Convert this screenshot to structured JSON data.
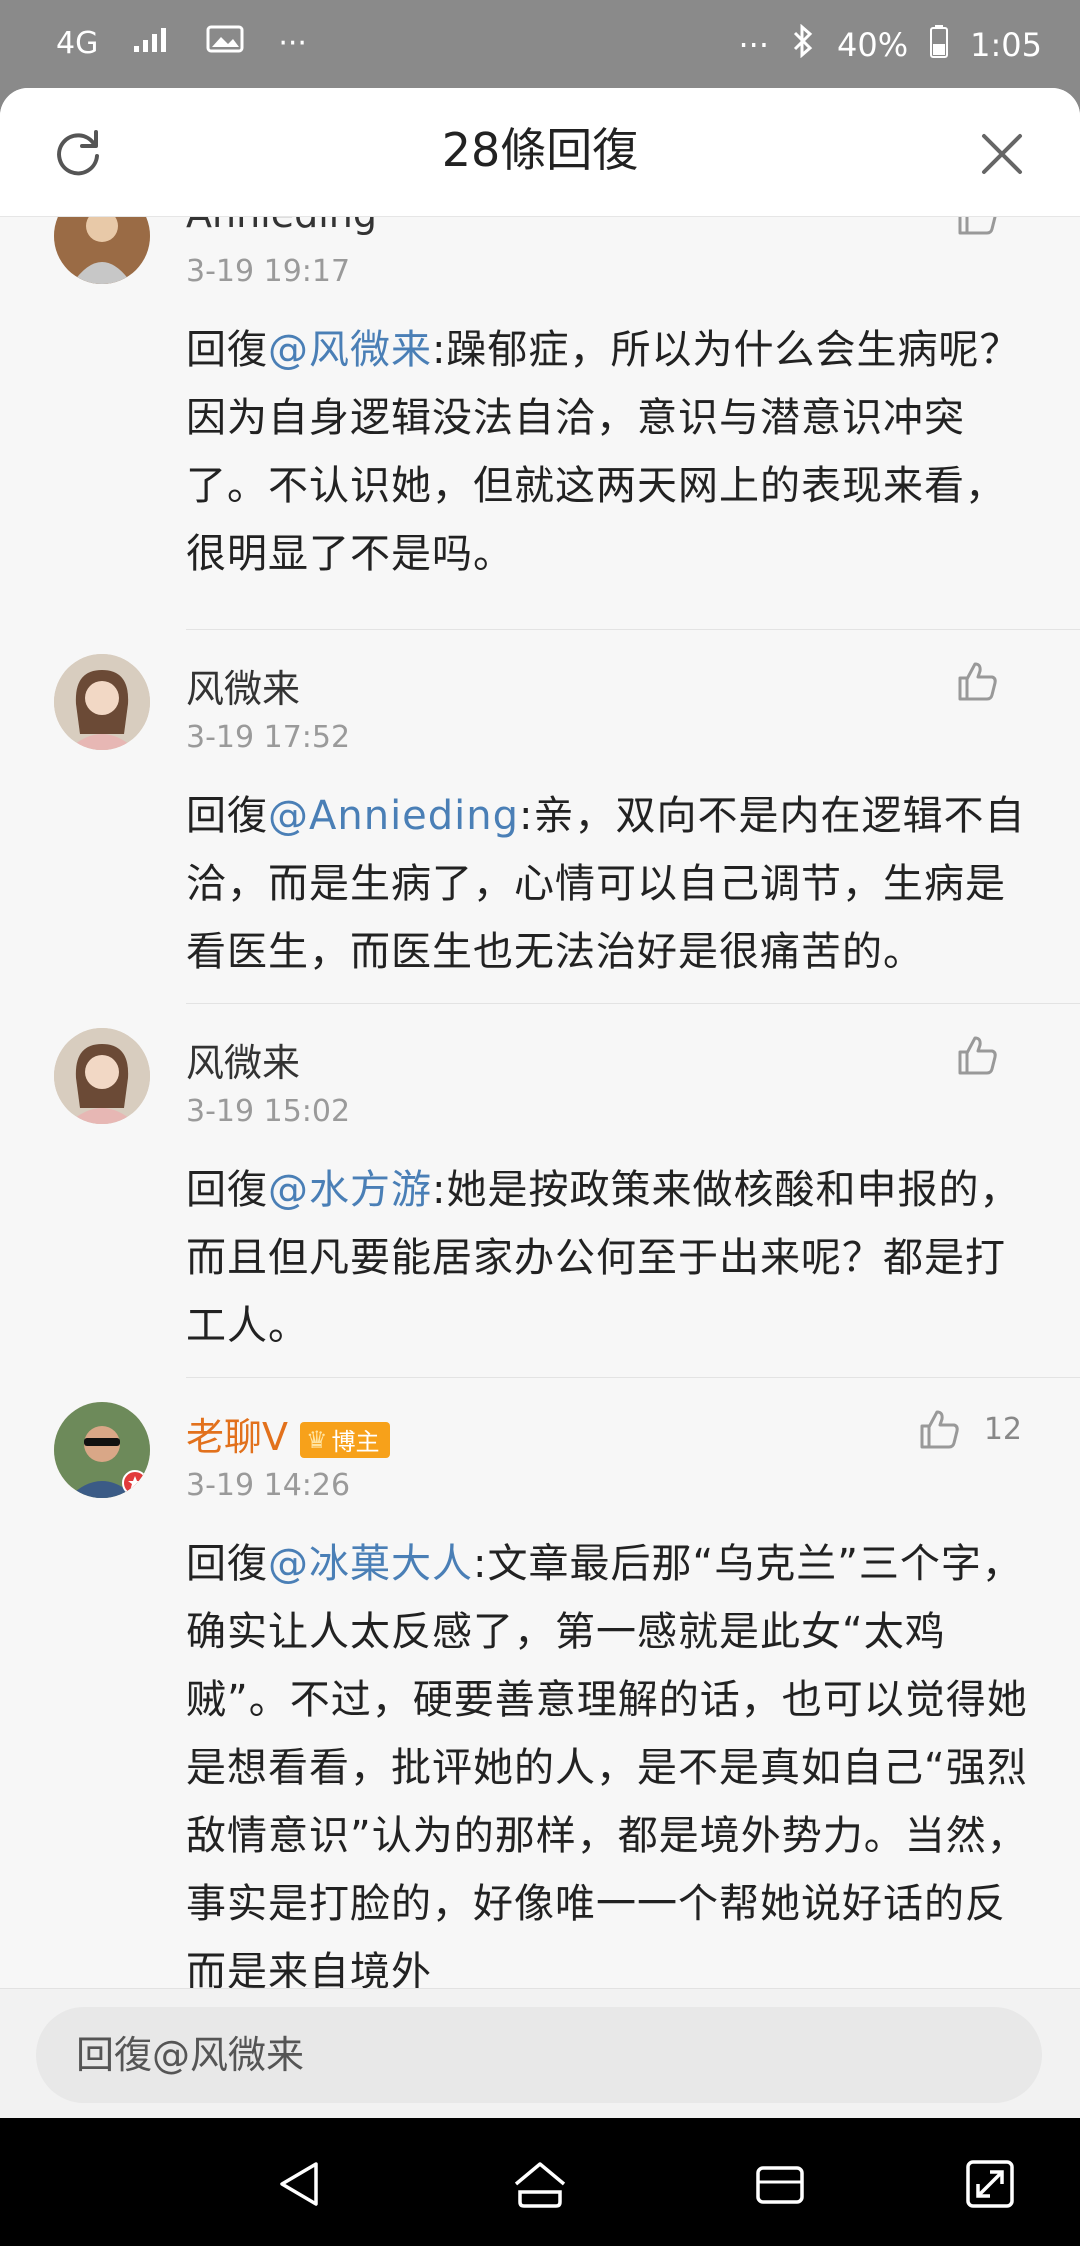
{
  "status_bar": {
    "network": "4G",
    "dots_left": "···",
    "dots_right": "···",
    "battery": "40%",
    "time": "1:05"
  },
  "header": {
    "title": "28條回復"
  },
  "comments": [
    {
      "name": "Annieding",
      "time": "3-19 19:17",
      "reply_prefix": "回復",
      "mention": "@风微来",
      "text": ":躁郁症，所以为什么会生病呢？因为自身逻辑没法自洽，意识与潜意识冲突了。不认识她，但就这两天网上的表现来看，很明显了不是吗。",
      "likes": ""
    },
    {
      "name": "风微来",
      "time": "3-19 17:52",
      "reply_prefix": "回復",
      "mention": "@Annieding",
      "text": ":亲，双向不是内在逻辑不自洽，而是生病了，心情可以自己调节，生病是看医生，而医生也无法治好是很痛苦的。",
      "likes": ""
    },
    {
      "name": "风微来",
      "time": "3-19 15:02",
      "reply_prefix": "回復",
      "mention": "@水方游",
      "text": ":她是按政策来做核酸和申报的，而且但凡要能居家办公何至于出来呢？都是打工人。",
      "likes": ""
    },
    {
      "name": "老聊V",
      "badge": "博主",
      "time": "3-19 14:26",
      "reply_prefix": "回復",
      "mention": "@冰菓大人",
      "text": ":文章最后那“乌克兰”三个字，确实让人太反感了，第一感就是此女“太鸡贼”。不过，硬要善意理解的话，也可以觉得她是想看看，批评她的人，是不是真如自己“强烈敌情意识”认为的那样，都是境外势力。当然，事实是打脸的，好像唯一一个帮她说好话的反而是来自境外",
      "likes": "12"
    }
  ],
  "reply_box": {
    "placeholder": "回復@风微来"
  },
  "colors": {
    "mention": "#4a7fb6",
    "vip_name": "#e2711c",
    "badge": "#f7a11a"
  }
}
